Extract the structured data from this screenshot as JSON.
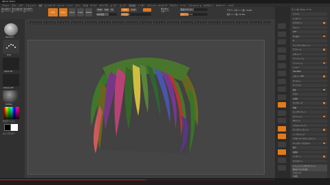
{
  "titlebar": {
    "title": "ZBrush 2018.1"
  },
  "menu": {
    "items": [
      "アルファ",
      "ブラシ",
      "カラー",
      "ドキュメント",
      "描画",
      "エッジループ",
      "ファイル",
      "レイヤー",
      "ライト",
      "マクロ",
      "マーカー",
      "マテリアル",
      "ムービー",
      "ピッカー",
      "環境設定",
      "レンダー",
      "ステンシル",
      "ストローク",
      "テクスチャ",
      "ツール",
      "トランスフォーム",
      "Zプラグイン",
      "Zスクリプト",
      "ヘルプ"
    ],
    "right": [
      "ホームページ",
      "クイックセーブ",
      "デフォルトZスクリプト"
    ]
  },
  "toolbar": {
    "home": "ホームページ",
    "lightbox": "ライトボックス",
    "liveboolean": "ライブブール",
    "edit": "Edit",
    "draw": "Draw",
    "move": "Move",
    "scale": "Scale",
    "rotate": "Rotate",
    "mrgb": "Mrgb",
    "rgb": "Rgb",
    "m": "M",
    "zadd": "Zadd",
    "zsub": "Zsub",
    "rgb_intensity": "Rgb強度",
    "z_intensity": "Z強度 25",
    "focal_shift": "焦点シフト 0",
    "draw_size": "描画サイズ 64",
    "dynamic": "ダイナミック",
    "active_points": "アクティブポイント数: 74,304",
    "total_points": "総ポイント数: 74,304"
  },
  "leftpanel": {
    "brush_label": "Standard",
    "stroke_label": "Dots",
    "alpha_label": "Alpha Off",
    "texture_label": "Texture Off",
    "material_label": "MatCap",
    "gradient_label": "グラデーション",
    "switch_color": "スイッチカラー"
  },
  "rightpanel": {
    "header": "ライトボックス ▸ ツール",
    "sections": [
      "ファイル",
      "インポート",
      "エクスポート",
      "クローン",
      "GoZ",
      "全て表示",
      "R",
      "ライトボックス▸ツール",
      "サブツール",
      "ジオメトリ",
      "アレイメッシュ",
      "ナノメッシュ",
      "レイヤー",
      "FiberMesh",
      "ジオメトリHD",
      "プレビュー",
      "サーフェス",
      "変形",
      "マスク",
      "可視性",
      "ポリグループ",
      "接触",
      "モーフターゲット",
      "ポリペイント",
      "UVマップ",
      "テクスチャマップ",
      "ディスプレイスメント",
      "ノーマルマップ",
      "ベクターディスプレイスメント",
      "ディスプレイプロパティ",
      "統合",
      "初期化",
      "インポート",
      "エクスポート"
    ],
    "bottom": [
      "ドキュメントに合わせてズーム",
      "周辺のマスクを反転",
      "マスキング",
      "可視性"
    ]
  },
  "colors": {
    "accent": "#e07a1f",
    "bg": "#2a2a2a",
    "canvas": "#454545"
  },
  "timeline_progress": 0.53
}
